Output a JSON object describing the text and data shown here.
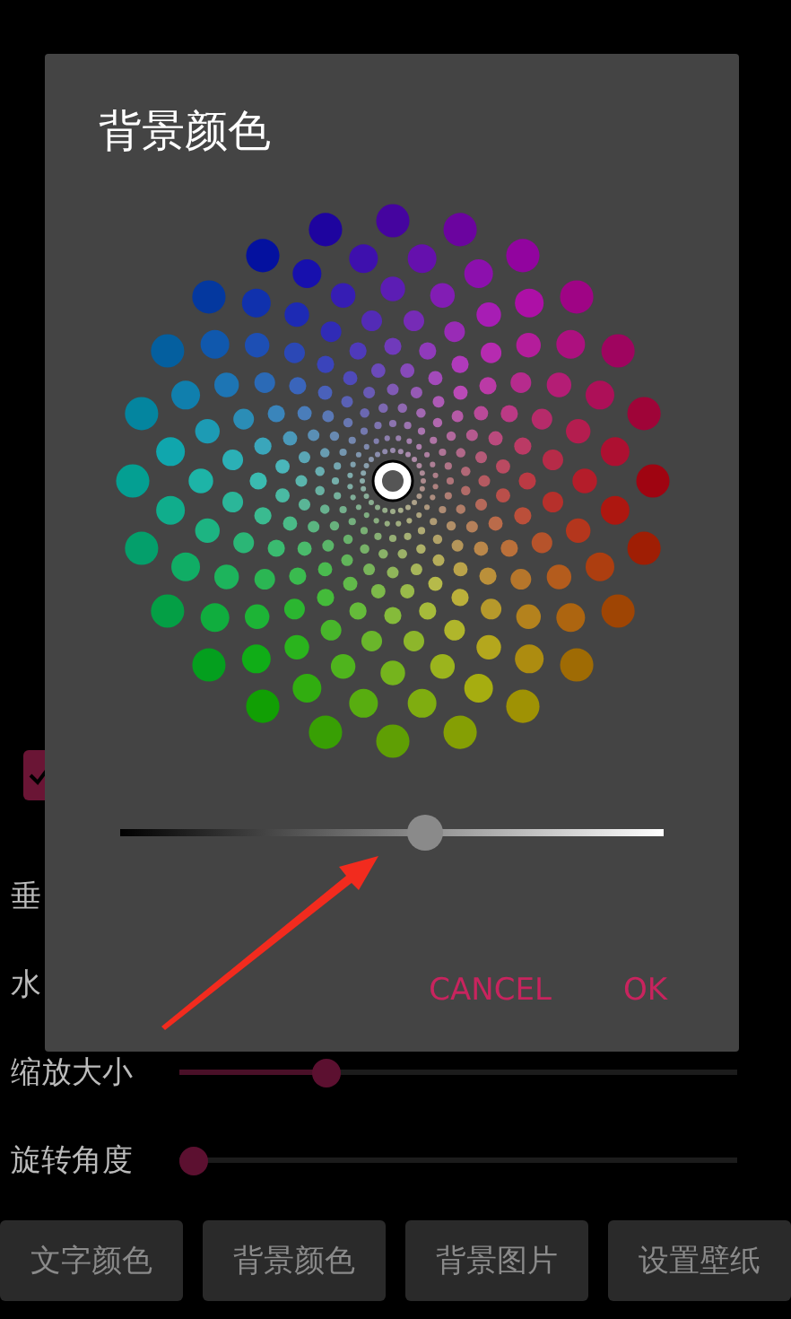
{
  "page": {
    "checkbox": {
      "checked": true
    },
    "labels": [
      "垂",
      "水"
    ],
    "sliders": [
      {
        "label": "缩放大小",
        "level": 0.25
      },
      {
        "label": "旋转角度",
        "level": 0
      }
    ],
    "buttons": [
      "文字颜色",
      "背景颜色",
      "背景图片",
      "设置壁纸"
    ]
  },
  "dialog": {
    "title": "背景颜色",
    "brightness": {
      "level": 0.56
    },
    "buttons": [
      "CANCEL",
      "OK"
    ]
  }
}
